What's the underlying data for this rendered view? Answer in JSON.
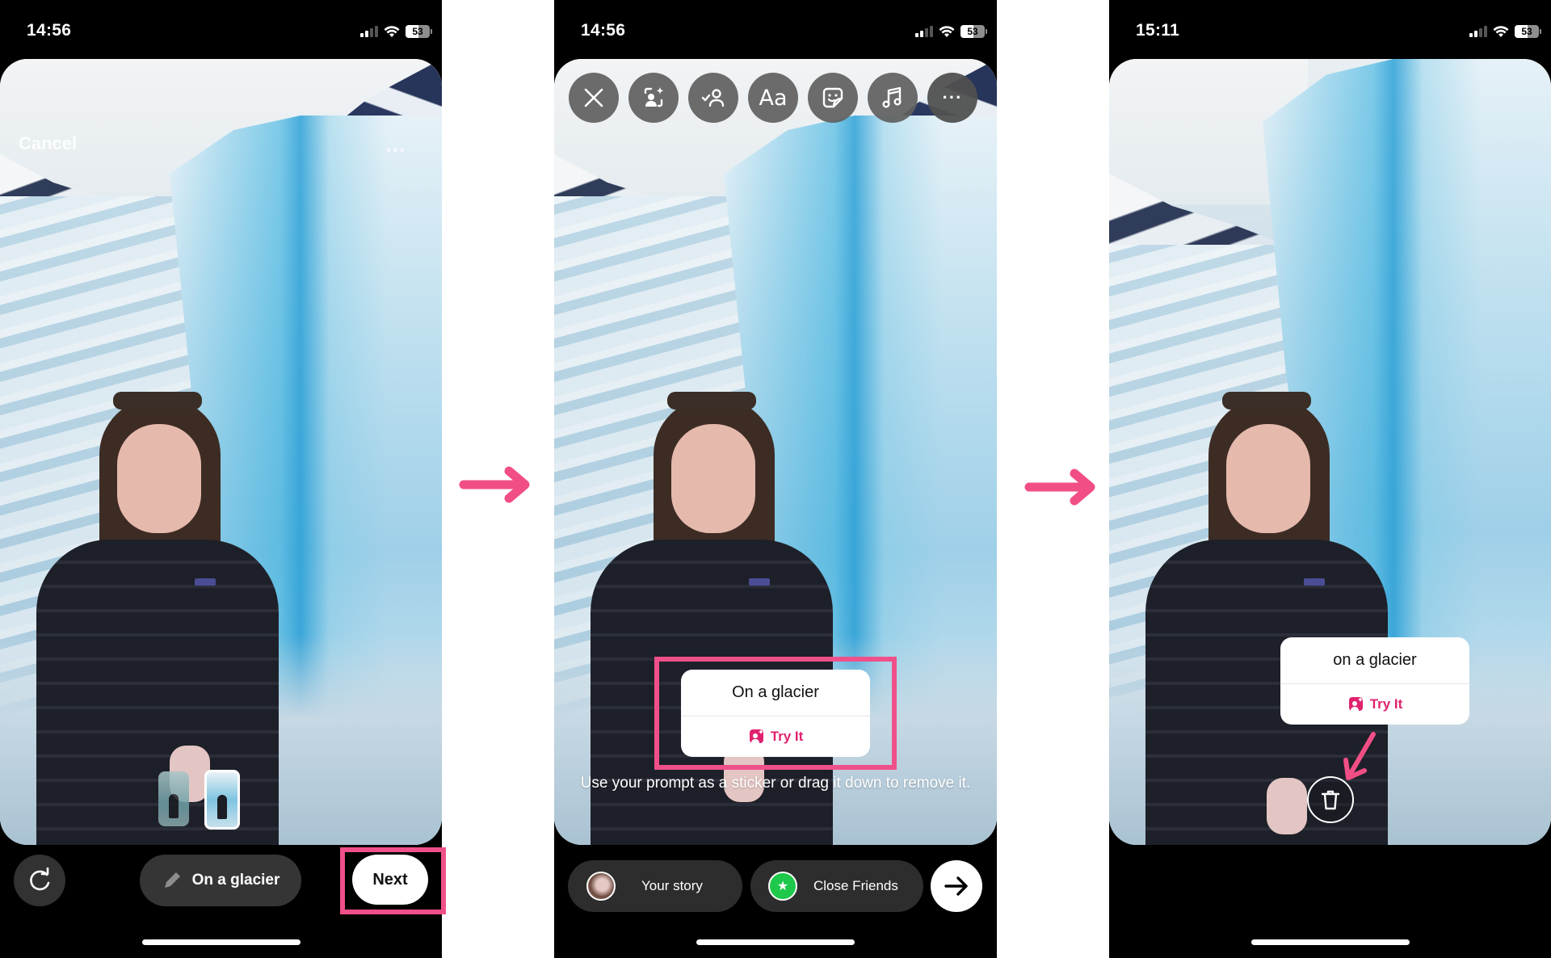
{
  "colors": {
    "highlight": "#f0508a",
    "try_it": "#e0226e",
    "close_friends": "#1ec84a"
  },
  "phones": [
    {
      "status": {
        "time": "14:56",
        "battery": "53"
      },
      "top": {
        "cancel_label": "Cancel",
        "more_icon": "more-horizontal-icon"
      },
      "thumbnails": [
        "original-photo",
        "generated-photo"
      ],
      "bottom": {
        "regenerate_icon": "refresh-icon",
        "prompt_label": "On a glacier",
        "prompt_icon": "pencil-icon",
        "next_label": "Next"
      }
    },
    {
      "status": {
        "time": "14:56",
        "battery": "53"
      },
      "toolbar": [
        {
          "name": "close",
          "icon": "close-icon"
        },
        {
          "name": "restyle",
          "icon": "ai-restyle-icon"
        },
        {
          "name": "mention",
          "icon": "mention-person-icon"
        },
        {
          "name": "text",
          "icon": "text-icon",
          "label": "Aa"
        },
        {
          "name": "sticker",
          "icon": "sticker-icon"
        },
        {
          "name": "music",
          "icon": "music-icon"
        },
        {
          "name": "more",
          "icon": "more-horizontal-icon",
          "label": "···"
        }
      ],
      "sticker": {
        "title": "On a glacier",
        "action": "Try It"
      },
      "hint": "Use your prompt as a sticker or drag it down to remove it.",
      "share": {
        "your_story": "Your story",
        "close_friends": "Close Friends",
        "send_icon": "arrow-right-icon"
      }
    },
    {
      "status": {
        "time": "15:11",
        "battery": "53"
      },
      "sticker": {
        "title": "on a glacier",
        "action": "Try It"
      },
      "trash_icon": "trash-icon"
    }
  ],
  "flow_arrows": [
    "step-1-to-2",
    "step-2-to-3"
  ]
}
